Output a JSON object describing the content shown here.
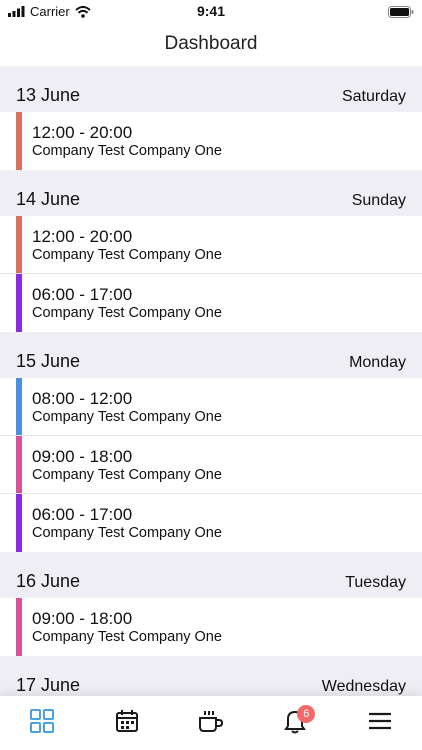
{
  "status": {
    "carrier": "Carrier",
    "time": "9:41"
  },
  "nav": {
    "title": "Dashboard"
  },
  "colors": {
    "salmon": "#d9705e",
    "purple": "#8a2be2",
    "blue": "#4a90e2",
    "pink": "#d65195",
    "accent": "#4aa3df",
    "badge": "#f06a6a"
  },
  "days": [
    {
      "date": "13 June",
      "weekday": "Saturday",
      "shifts": [
        {
          "time": "12:00 - 20:00",
          "company": "Company Test Company One",
          "color": "salmon"
        }
      ]
    },
    {
      "date": "14 June",
      "weekday": "Sunday",
      "shifts": [
        {
          "time": "12:00 - 20:00",
          "company": "Company Test Company One",
          "color": "salmon"
        },
        {
          "time": "06:00 - 17:00",
          "company": "Company Test Company One",
          "color": "purple"
        }
      ]
    },
    {
      "date": "15 June",
      "weekday": "Monday",
      "shifts": [
        {
          "time": "08:00 - 12:00",
          "company": "Company Test Company One",
          "color": "blue"
        },
        {
          "time": "09:00 - 18:00",
          "company": "Company Test Company One",
          "color": "pink"
        },
        {
          "time": "06:00 - 17:00",
          "company": "Company Test Company One",
          "color": "purple"
        }
      ]
    },
    {
      "date": "16 June",
      "weekday": "Tuesday",
      "shifts": [
        {
          "time": "09:00 - 18:00",
          "company": "Company Test Company One",
          "color": "pink"
        }
      ]
    },
    {
      "date": "17 June",
      "weekday": "Wednesday",
      "shifts": [
        {
          "time": "",
          "company": "",
          "color": "blue"
        }
      ]
    }
  ],
  "tabs": [
    {
      "name": "dashboard",
      "icon": "grid-icon",
      "active": true
    },
    {
      "name": "calendar",
      "icon": "calendar-icon",
      "active": false
    },
    {
      "name": "break",
      "icon": "coffee-icon",
      "active": false
    },
    {
      "name": "notifications",
      "icon": "bell-icon",
      "active": false,
      "badge": "6"
    },
    {
      "name": "menu",
      "icon": "hamburger-icon",
      "active": false
    }
  ]
}
